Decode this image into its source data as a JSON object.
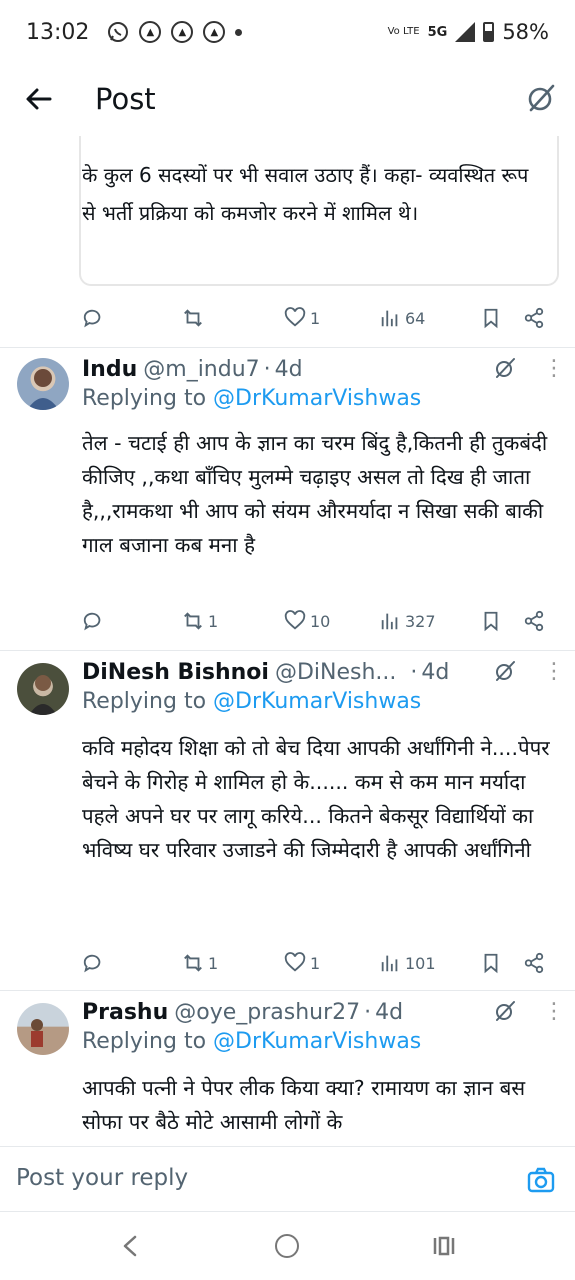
{
  "status_bar": {
    "time": "13:02",
    "network_label": "5G",
    "volte_label": "Vo LTE",
    "battery": "58%",
    "icons": [
      "whatsapp-icon",
      "news-app-icon",
      "news-app-icon",
      "news-app-icon",
      "more-notifications-dot"
    ]
  },
  "header": {
    "title": "Post",
    "back_icon": "back-arrow-icon",
    "right_icon": "grok-icon"
  },
  "quoted_post": {
    "text": "के कुल 6 सदस्यों पर भी सवाल उठाए हैं। कहा- व्यवस्थित रूप से भर्ती प्रक्रिया को कमजोर करने में शामिल थे।",
    "stats": {
      "reposts": "",
      "likes": "1",
      "views": "64"
    }
  },
  "replies": [
    {
      "name": "Indu",
      "handle": "@m_indu7",
      "time": "4d",
      "replying_prefix": "Replying to",
      "replying_to": "@DrKumarVishwas",
      "text": "तेल - चटाई ही आप के ज्ञान का चरम बिंदु है,कितनी ही तुकबंदी कीजिए ,,कथा बाँचिए मुलम्मे  चढ़ाइए असल तो दिख ही जाता है,,,रामकथा भी आप को संयम औरमर्यादा न सिखा सकी बाकी गाल बजाना कब मना है",
      "stats": {
        "reposts": "1",
        "likes": "10",
        "views": "327"
      }
    },
    {
      "name": "DiNesh Bishnoi",
      "handle": "@DiNesh...",
      "time": "4d",
      "replying_prefix": "Replying to",
      "replying_to": "@DrKumarVishwas",
      "text": "कवि महोदय शिक्षा को तो बेच दिया आपकी अर्धांगिनी ने....पेपर बेचने के गिरोह मे शामिल हो के...... कम से कम मान मर्यादा पहले अपने घर पर लागू करिये... कितने बेकसूर विद्यार्थियों का भविष्य घर परिवार उजाडने की जिम्मेदारी है आपकी अर्धांगिनी",
      "stats": {
        "reposts": "1",
        "likes": "1",
        "views": "101"
      }
    },
    {
      "name": "Prashu",
      "handle": "@oye_prashur27",
      "time": "4d",
      "replying_prefix": "Replying to",
      "replying_to": "@DrKumarVishwas",
      "text": "आपकी पत्नी ने पेपर लीक किया क्या? रामायण का ज्ञान बस सोफा पर बैठे मोटे आसामी लोगों के"
    }
  ],
  "reply_bar": {
    "placeholder": "Post your reply",
    "camera_icon": "camera-icon"
  },
  "nav_bar": {
    "icons": [
      "nav-back-icon",
      "nav-home-icon",
      "nav-recents-icon"
    ]
  },
  "colors": {
    "accent": "#1d9bf0",
    "secondary_text": "#536471",
    "primary_text": "#0f1419"
  }
}
